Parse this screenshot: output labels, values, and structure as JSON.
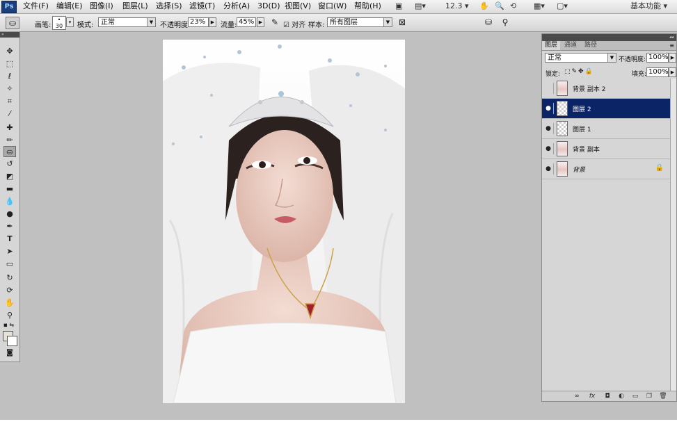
{
  "menubar": {
    "logo": "Ps",
    "items": [
      "文件(F)",
      "编辑(E)",
      "图像(I)",
      "图层(L)",
      "选择(S)",
      "滤镜(T)",
      "分析(A)",
      "3D(D)",
      "视图(V)",
      "窗口(W)",
      "帮助(H)"
    ],
    "zoom": "12.3",
    "workspace": "基本功能"
  },
  "options": {
    "brush_label": "画笔:",
    "brush_size": "30",
    "mode_label": "模式:",
    "mode_value": "正常",
    "opacity_label": "不透明度:",
    "opacity_value": "23%",
    "flow_label": "流量:",
    "flow_value": "45%",
    "align_label": "对齐",
    "sample_label": "样本:",
    "sample_value": "所有图层"
  },
  "panel": {
    "tabs": [
      "图层",
      "通道",
      "路径"
    ],
    "blend_mode": "正常",
    "opacity_label": "不透明度:",
    "opacity_value": "100%",
    "lock_label": "锁定:",
    "fill_label": "填充:",
    "fill_value": "100%",
    "layers": [
      {
        "name": "背景 副本 2",
        "visible": false,
        "selected": false,
        "thumb": "img"
      },
      {
        "name": "图层 2",
        "visible": true,
        "selected": true,
        "thumb": "checker"
      },
      {
        "name": "图层 1",
        "visible": true,
        "selected": false,
        "thumb": "checker"
      },
      {
        "name": "背景 副本",
        "visible": true,
        "selected": false,
        "thumb": "img"
      },
      {
        "name": "背景",
        "visible": true,
        "selected": false,
        "thumb": "img",
        "locked": true
      }
    ]
  },
  "colors": {
    "selection": "#0b2466",
    "workspace": "#c0c0c0",
    "foreground": "#e6e2d6",
    "background": "#ffffff"
  }
}
